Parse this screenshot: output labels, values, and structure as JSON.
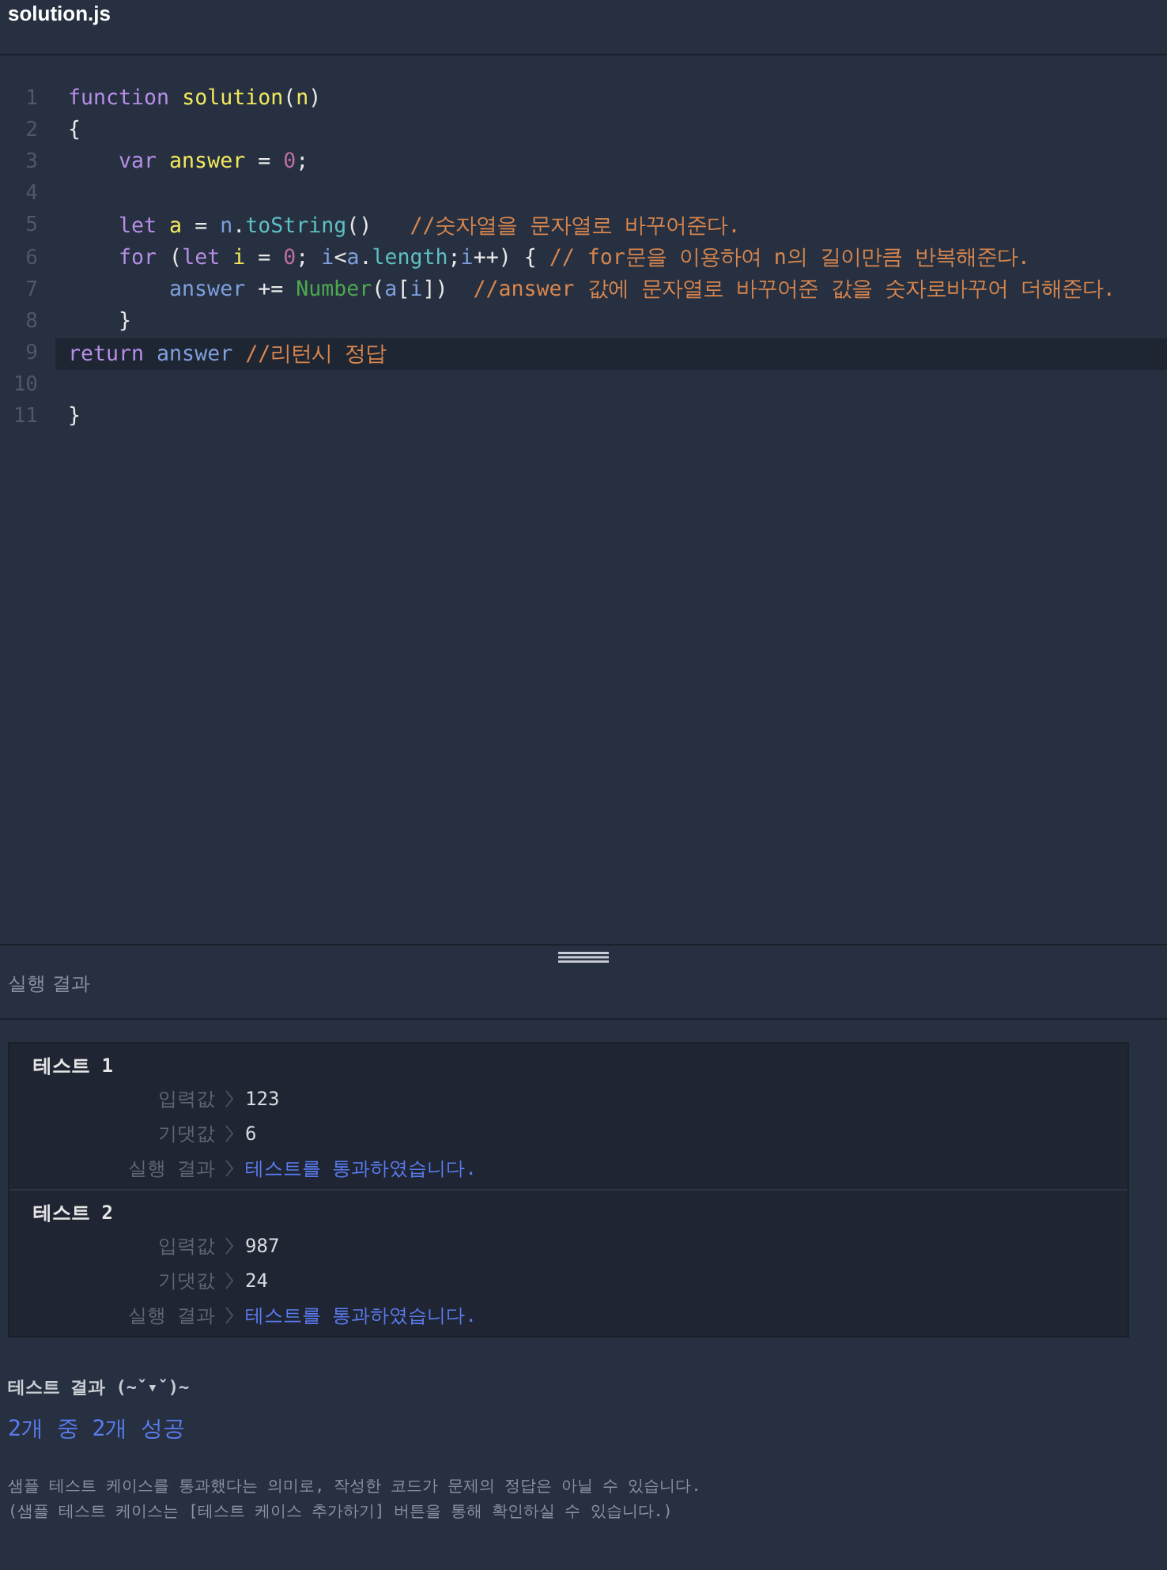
{
  "editor": {
    "filename": "solution.js",
    "lines": [
      {
        "number": "1",
        "active": false,
        "tokens": [
          {
            "kind": "keyword",
            "text": "function "
          },
          {
            "kind": "fn",
            "text": "solution"
          },
          {
            "kind": "plain",
            "text": "("
          },
          {
            "kind": "fn",
            "text": "n"
          },
          {
            "kind": "plain",
            "text": ")"
          }
        ]
      },
      {
        "number": "2",
        "active": false,
        "tokens": [
          {
            "kind": "plain",
            "text": "{"
          }
        ]
      },
      {
        "number": "3",
        "active": false,
        "tokens": [
          {
            "kind": "keyword",
            "text": "    var "
          },
          {
            "kind": "fn",
            "text": "answer"
          },
          {
            "kind": "plain",
            "text": " = "
          },
          {
            "kind": "number",
            "text": "0"
          },
          {
            "kind": "plain",
            "text": ";"
          }
        ]
      },
      {
        "number": "4",
        "active": false
      },
      {
        "number": "5",
        "active": false,
        "tokens": [
          {
            "kind": "keyword",
            "text": "    let "
          },
          {
            "kind": "fn",
            "text": "a"
          },
          {
            "kind": "plain",
            "text": " = "
          },
          {
            "kind": "var",
            "text": "n"
          },
          {
            "kind": "plain",
            "text": "."
          },
          {
            "kind": "method",
            "text": "toString"
          },
          {
            "kind": "plain",
            "text": "()   "
          },
          {
            "kind": "comment",
            "text": "//숫자열을 문자열로 바꾸어준다."
          }
        ]
      },
      {
        "number": "6",
        "active": false,
        "tokens": [
          {
            "kind": "keyword",
            "text": "    for "
          },
          {
            "kind": "plain",
            "text": "("
          },
          {
            "kind": "keyword",
            "text": "let "
          },
          {
            "kind": "fn",
            "text": "i"
          },
          {
            "kind": "plain",
            "text": " = "
          },
          {
            "kind": "number",
            "text": "0"
          },
          {
            "kind": "plain",
            "text": "; "
          },
          {
            "kind": "var",
            "text": "i"
          },
          {
            "kind": "plain",
            "text": "<"
          },
          {
            "kind": "var",
            "text": "a"
          },
          {
            "kind": "plain",
            "text": "."
          },
          {
            "kind": "method",
            "text": "length"
          },
          {
            "kind": "plain",
            "text": ";"
          },
          {
            "kind": "var",
            "text": "i"
          },
          {
            "kind": "plain",
            "text": "++) { "
          },
          {
            "kind": "comment",
            "text": "// for문을 이용하여 n의 길이만큼 반복해준다."
          }
        ]
      },
      {
        "number": "7",
        "active": false,
        "tokens": [
          {
            "kind": "var",
            "text": "        answer"
          },
          {
            "kind": "plain",
            "text": " += "
          },
          {
            "kind": "builtin",
            "text": "Number"
          },
          {
            "kind": "plain",
            "text": "("
          },
          {
            "kind": "var",
            "text": "a"
          },
          {
            "kind": "plain",
            "text": "["
          },
          {
            "kind": "var",
            "text": "i"
          },
          {
            "kind": "plain",
            "text": "])  "
          },
          {
            "kind": "comment",
            "text": "//answer 값에 문자열로 바꾸어준 값을 숫자로바꾸어 더해준다."
          }
        ]
      },
      {
        "number": "8",
        "active": false,
        "tokens": [
          {
            "kind": "plain",
            "text": "    }"
          }
        ]
      },
      {
        "number": "9",
        "active": true,
        "tokens": [
          {
            "kind": "keyword",
            "text": "return "
          },
          {
            "kind": "var",
            "text": "answer"
          },
          {
            "kind": "comment",
            "text": " //리턴시 정답"
          }
        ]
      },
      {
        "number": "10",
        "active": false
      },
      {
        "number": "11",
        "active": false,
        "tokens": [
          {
            "kind": "plain",
            "text": "}"
          }
        ]
      }
    ]
  },
  "results": {
    "heading": "실행 결과",
    "tests": [
      {
        "title": "테스트 1",
        "rows": [
          {
            "label": "입력값",
            "value": "123",
            "kind": "value"
          },
          {
            "label": "기댓값",
            "value": "6",
            "kind": "value"
          },
          {
            "label": "실행 결과",
            "value": "테스트를 통과하였습니다.",
            "kind": "result"
          }
        ]
      },
      {
        "title": "테스트 2",
        "rows": [
          {
            "label": "입력값",
            "value": "987",
            "kind": "value"
          },
          {
            "label": "기댓값",
            "value": "24",
            "kind": "value"
          },
          {
            "label": "실행 결과",
            "value": "테스트를 통과하였습니다.",
            "kind": "result"
          }
        ]
      }
    ],
    "summary_title": "테스트 결과 (~ˇ▾ˇ)~",
    "summary": "2개 중 2개 성공",
    "notes": [
      "샘플 테스트 케이스를 통과했다는 의미로, 작성한 코드가 문제의 정답은 아닐 수 있습니다.",
      "(샘플 테스트 케이스는 [테스트 케이스 추가하기] 버튼을 통해 확인하실 수 있습니다.)"
    ]
  }
}
